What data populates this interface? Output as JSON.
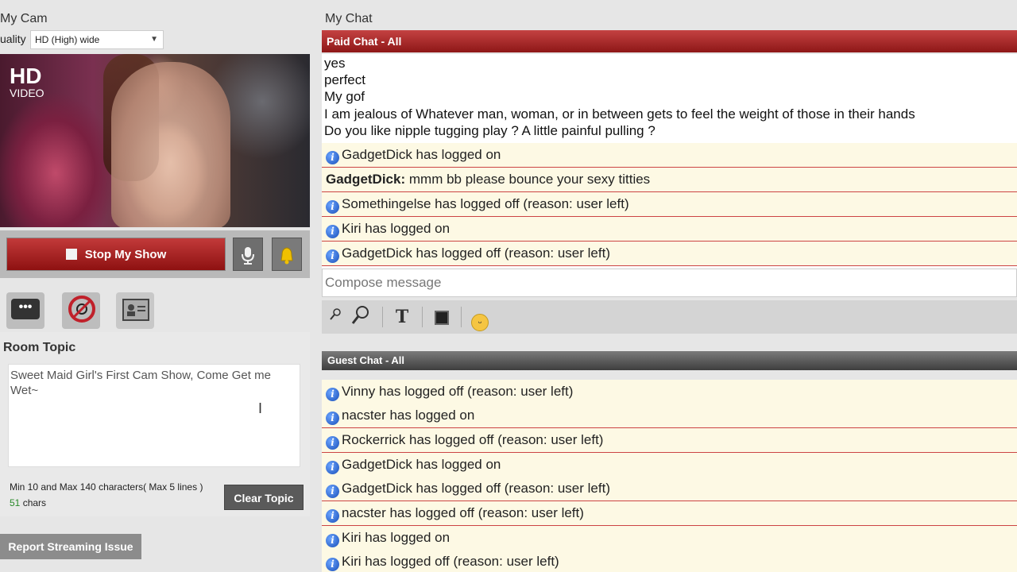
{
  "cam": {
    "title": "My Cam",
    "quality_label": "uality",
    "quality_value": "HD (High) wide",
    "hd_badge": "HD",
    "hd_badge_sub": "VIDEO",
    "stop_label": "Stop My Show"
  },
  "room_topic": {
    "heading": "Room Topic",
    "text": "Sweet Maid Girl's First Cam Show, Come Get me Wet~",
    "hint": "Min 10 and Max 140 characters( Max 5 lines )",
    "count": "51",
    "count_suffix": "chars",
    "clear_label": "Clear Topic"
  },
  "report_label": "Report Streaming Issue",
  "chat": {
    "title": "My Chat",
    "paid_header": "Paid Chat - All",
    "paid_plain": [
      "yes",
      "perfect",
      "My gof",
      "I am jealous of Whatever man, woman, or in between gets to feel the weight of those in their hands",
      "Do you like nipple tugging play ? A little painful pulling ?"
    ],
    "paid_notes": [
      {
        "type": "info",
        "text": "GadgetDick has logged on"
      },
      {
        "type": "msg",
        "sender": "GadgetDick:",
        "text": "mmm bb please bounce your sexy titties"
      },
      {
        "type": "info",
        "text": "Somethingelse has logged off (reason: user left)"
      },
      {
        "type": "info",
        "text": "Kiri has logged on"
      },
      {
        "type": "info",
        "text": "GadgetDick has logged off (reason: user left)"
      }
    ],
    "compose_placeholder": "Compose message",
    "guest_header": "Guest Chat - All",
    "guest_notes": [
      "Vinny has logged off (reason: user left)",
      "nacster has logged on",
      "Rockerrick has logged off (reason: user left)",
      "GadgetDick has logged on",
      "GadgetDick has logged off (reason: user left)",
      "nacster has logged off (reason: user left)",
      "Kiri has logged on",
      "Kiri has logged off (reason: user left)"
    ]
  },
  "icons": {
    "info": "i",
    "chat": "•••",
    "caret": "▼"
  }
}
